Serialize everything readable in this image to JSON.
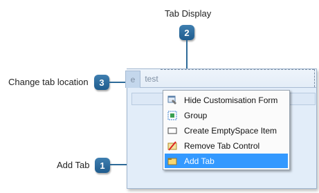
{
  "callouts": {
    "tab_display": {
      "label": "Tab Display",
      "number": "2"
    },
    "change_tab_location": {
      "label": "Change tab location",
      "number": "3"
    },
    "add_tab": {
      "label": "Add Tab",
      "number": "1"
    }
  },
  "tabs": [
    {
      "label": "e"
    },
    {
      "label": "test"
    }
  ],
  "context_menu": {
    "items": [
      {
        "label": "Hide Customisation Form",
        "icon": "customisation-form-icon"
      },
      {
        "label": "Group",
        "icon": "group-icon"
      },
      {
        "label": "Create EmptySpace Item",
        "icon": "empty-space-icon"
      },
      {
        "label": "Remove Tab Control",
        "icon": "remove-tab-icon"
      },
      {
        "label": "Add Tab",
        "icon": "add-tab-icon",
        "highlighted": true
      }
    ]
  },
  "colors": {
    "badge": "#2d6a98",
    "menu_highlight": "#3399ff",
    "form_background": "#e2edf9"
  }
}
